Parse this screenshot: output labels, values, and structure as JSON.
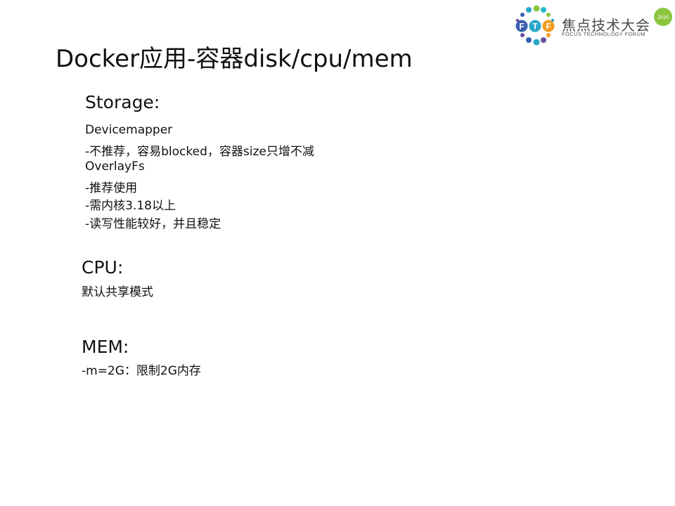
{
  "logo": {
    "letters": [
      "F",
      "T",
      "F"
    ],
    "cn_name": "焦点技术大会",
    "en_name": "FOCUS TECHNOLOGY FORUM",
    "year": "2016",
    "colors": {
      "blue": "#3a5fb0",
      "teal": "#27a7c9",
      "green": "#8cc63f",
      "purple": "#6b4fa0",
      "orange": "#f39a1f",
      "cyan": "#22b7c7"
    }
  },
  "title": "Docker应用-容器disk/cpu/mem",
  "storage": {
    "heading": "Storage:",
    "lines": [
      "Devicemapper",
      "-不推荐，容易blocked，容器size只增不减",
      "OverlayFs",
      "-推荐使用",
      "-需内核3.18以上",
      "-读写性能较好，并且稳定"
    ]
  },
  "cpu": {
    "heading": "CPU:",
    "lines": [
      "默认共享模式"
    ]
  },
  "mem": {
    "heading": "MEM:",
    "lines": [
      "-m=2G：限制2G内存"
    ]
  }
}
